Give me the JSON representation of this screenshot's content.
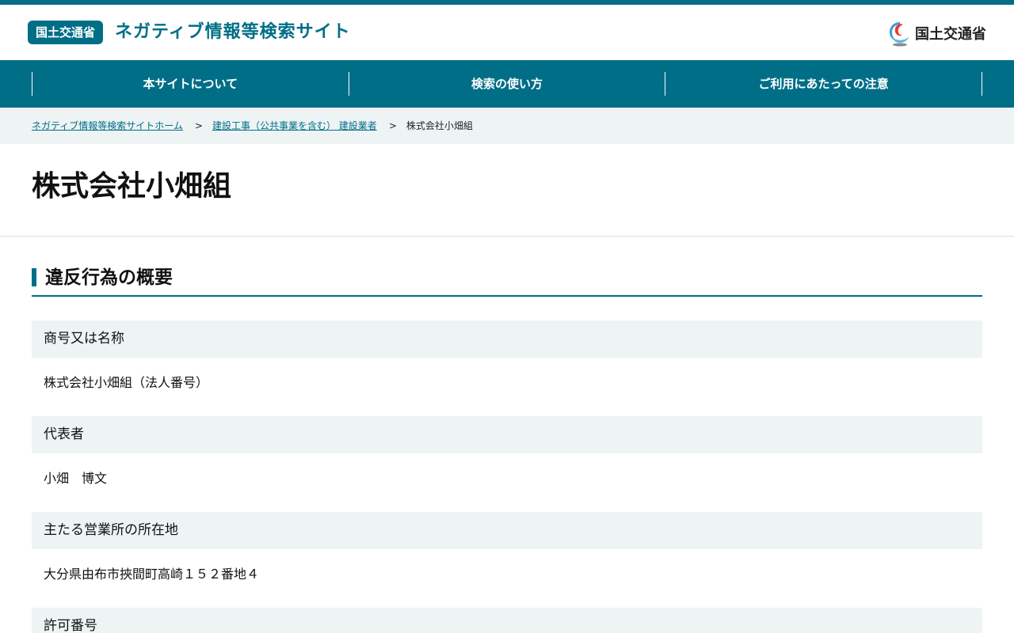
{
  "header": {
    "badge": "国土交通省",
    "title": "ネガティブ情報等検索サイト",
    "logo_text": "国土交通省"
  },
  "nav": {
    "items": [
      {
        "label": "本サイトについて"
      },
      {
        "label": "検索の使い方"
      },
      {
        "label": "ご利用にあたっての注意"
      }
    ]
  },
  "breadcrumb": {
    "home": "ネガティブ情報等検索サイトホーム",
    "category": "建設工事（公共事業を含む） 建設業者",
    "current": "株式会社小畑組",
    "separator": ">"
  },
  "page": {
    "title": "株式会社小畑組"
  },
  "section": {
    "title": "違反行為の概要"
  },
  "details": [
    {
      "term": "商号又は名称",
      "value": "株式会社小畑組（法人番号）"
    },
    {
      "term": "代表者",
      "value": "小畑　博文"
    },
    {
      "term": "主たる営業所の所在地",
      "value": "大分県由布市挾間町高崎１５２番地４"
    },
    {
      "term": "許可番号",
      "value": ""
    }
  ],
  "colors": {
    "brand": "#006e87",
    "term_bg": "#eef3f4"
  }
}
